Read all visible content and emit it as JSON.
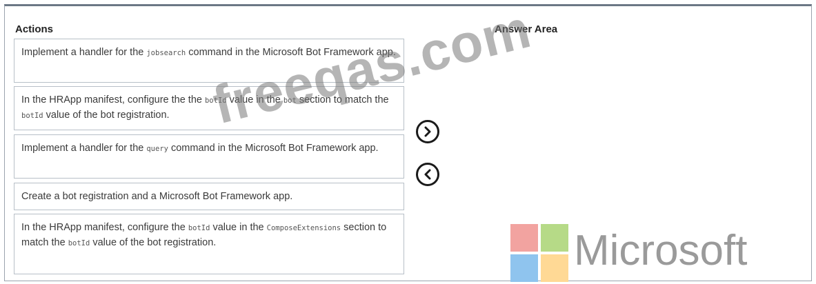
{
  "headers": {
    "actions": "Actions",
    "answer_area": "Answer Area"
  },
  "actions": [
    {
      "parts": [
        {
          "t": "Implement a handler for the ",
          "mono": false
        },
        {
          "t": "jobsearch",
          "mono": true
        },
        {
          "t": " command in the Microsoft Bot Framework app.",
          "mono": false
        }
      ]
    },
    {
      "parts": [
        {
          "t": "In the HRApp manifest, configure the the ",
          "mono": false
        },
        {
          "t": "botId",
          "mono": true
        },
        {
          "t": " value in the ",
          "mono": false
        },
        {
          "t": "bot",
          "mono": true
        },
        {
          "t": " section to match the ",
          "mono": false
        },
        {
          "t": "botId",
          "mono": true
        },
        {
          "t": " value of the bot registration.",
          "mono": false
        }
      ]
    },
    {
      "parts": [
        {
          "t": "Implement a handler for the ",
          "mono": false
        },
        {
          "t": "query",
          "mono": true
        },
        {
          "t": " command in the Microsoft Bot Framework app.",
          "mono": false
        }
      ]
    },
    {
      "parts": [
        {
          "t": "Create a bot registration and a Microsoft Bot Framework app.",
          "mono": false
        }
      ]
    },
    {
      "parts": [
        {
          "t": "In the HRApp manifest, configure the ",
          "mono": false
        },
        {
          "t": "botId",
          "mono": true
        },
        {
          "t": " value in the ",
          "mono": false
        },
        {
          "t": "ComposeExtensions",
          "mono": true
        },
        {
          "t": " section to match the ",
          "mono": false
        },
        {
          "t": "botId",
          "mono": true
        },
        {
          "t": " value of the bot registration.",
          "mono": false
        }
      ]
    }
  ],
  "controls": {
    "move_right_icon": "chevron-right-icon",
    "move_left_icon": "chevron-left-icon"
  },
  "watermark": "freeqas.com",
  "logo": {
    "text": "Microsoft",
    "colors": [
      "#f2a3a0",
      "#b6da87",
      "#8fc4ee",
      "#ffd995"
    ]
  }
}
